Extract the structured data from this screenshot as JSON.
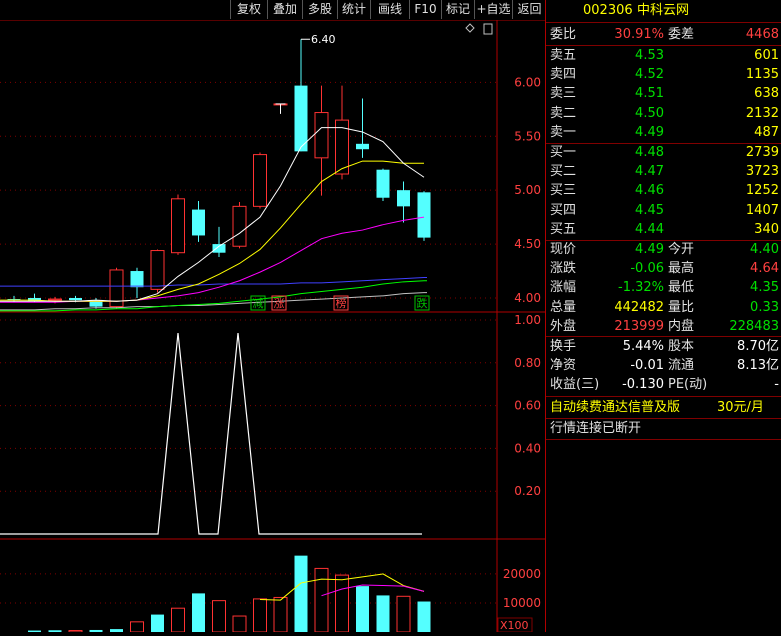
{
  "toolbar": {
    "buttons": [
      "复权",
      "叠加",
      "多股",
      "统计",
      "画线",
      "F10",
      "标记",
      "+自选",
      "返回"
    ]
  },
  "stock": {
    "code": "002306",
    "name": "中科云网"
  },
  "weibi": {
    "label1": "委比",
    "value1": "30.91%",
    "label2": "委差",
    "value2": "4468"
  },
  "asks": [
    {
      "label": "卖五",
      "price": "4.53",
      "volume": "601"
    },
    {
      "label": "卖四",
      "price": "4.52",
      "volume": "1135"
    },
    {
      "label": "卖三",
      "price": "4.51",
      "volume": "638"
    },
    {
      "label": "卖二",
      "price": "4.50",
      "volume": "2132"
    },
    {
      "label": "卖一",
      "price": "4.49",
      "volume": "487"
    }
  ],
  "bids": [
    {
      "label": "买一",
      "price": "4.48",
      "volume": "2739"
    },
    {
      "label": "买二",
      "price": "4.47",
      "volume": "3723"
    },
    {
      "label": "买三",
      "price": "4.46",
      "volume": "1252"
    },
    {
      "label": "买四",
      "price": "4.45",
      "volume": "1407"
    },
    {
      "label": "买五",
      "price": "4.44",
      "volume": "340"
    }
  ],
  "quote": [
    {
      "l1": "现价",
      "v1": "4.49",
      "c1": "green",
      "l2": "今开",
      "v2": "4.40",
      "c2": "green"
    },
    {
      "l1": "涨跌",
      "v1": "-0.06",
      "c1": "green",
      "l2": "最高",
      "v2": "4.64",
      "c2": "red"
    },
    {
      "l1": "涨幅",
      "v1": "-1.32%",
      "c1": "green",
      "l2": "最低",
      "v2": "4.35",
      "c2": "green"
    },
    {
      "l1": "总量",
      "v1": "442482",
      "c1": "yellow",
      "l2": "量比",
      "v2": "0.33",
      "c2": "green"
    },
    {
      "l1": "外盘",
      "v1": "213999",
      "c1": "red",
      "l2": "内盘",
      "v2": "228483",
      "c2": "green"
    }
  ],
  "fundamentals": [
    {
      "l1": "换手",
      "v1": "5.44%",
      "l2": "股本",
      "v2": "8.70亿"
    },
    {
      "l1": "净资",
      "v1": "-0.01",
      "l2": "流通",
      "v2": "8.13亿"
    },
    {
      "l1": "收益(三)",
      "v1": "-0.130",
      "l2": "PE(动)",
      "v2": "-"
    }
  ],
  "ad": {
    "text": "自动续费通达信普及版",
    "price": "30元/月"
  },
  "status": "行情连接已断开",
  "chart_data": [
    {
      "type": "candlestick",
      "title": "",
      "yticks": [
        6.0,
        5.5,
        5.0,
        4.5,
        4.0
      ],
      "ylim": [
        3.87,
        6.56
      ],
      "max_annotation": "6.40",
      "marks": [
        "减",
        "涨",
        "榜",
        "跌"
      ],
      "colors": {
        "up": "#ff3232",
        "down": "#54ffff",
        "ma5": "#ffffff",
        "ma10": "#ffff00",
        "ma20": "#ff00ff",
        "ma60": "#00ff00",
        "ma120": "#4040ff",
        "ma250": "#c0c0c0"
      },
      "candles": [
        {
          "o": 3.99,
          "h": 4.02,
          "l": 3.96,
          "c": 3.98
        },
        {
          "o": 4.0,
          "h": 4.04,
          "l": 3.96,
          "c": 3.97
        },
        {
          "o": 3.98,
          "h": 4.01,
          "l": 3.95,
          "c": 3.99
        },
        {
          "o": 4.0,
          "h": 4.02,
          "l": 3.96,
          "c": 3.98
        },
        {
          "o": 3.98,
          "h": 4.0,
          "l": 3.9,
          "c": 3.92
        },
        {
          "o": 3.92,
          "h": 4.28,
          "l": 3.9,
          "c": 4.26
        },
        {
          "o": 4.25,
          "h": 4.28,
          "l": 4.0,
          "c": 4.1
        },
        {
          "o": 4.08,
          "h": 4.45,
          "l": 4.05,
          "c": 4.44
        },
        {
          "o": 4.42,
          "h": 4.96,
          "l": 4.4,
          "c": 4.92
        },
        {
          "o": 4.82,
          "h": 4.9,
          "l": 4.52,
          "c": 4.58
        },
        {
          "o": 4.5,
          "h": 4.66,
          "l": 4.38,
          "c": 4.42
        },
        {
          "o": 4.48,
          "h": 4.89,
          "l": 4.46,
          "c": 4.85
        },
        {
          "o": 4.85,
          "h": 5.35,
          "l": 4.83,
          "c": 5.33
        },
        {
          "o": 5.8,
          "h": 5.8,
          "l": 5.8,
          "c": 5.8
        },
        {
          "o": 5.97,
          "h": 6.4,
          "l": 5.36,
          "c": 5.36
        },
        {
          "o": 5.3,
          "h": 5.97,
          "l": 4.95,
          "c": 5.72
        },
        {
          "o": 5.15,
          "h": 5.97,
          "l": 5.1,
          "c": 5.65
        },
        {
          "o": 5.43,
          "h": 5.85,
          "l": 5.3,
          "c": 5.38
        },
        {
          "o": 5.19,
          "h": 5.2,
          "l": 4.9,
          "c": 4.93
        },
        {
          "o": 5.0,
          "h": 5.08,
          "l": 4.7,
          "c": 4.85
        },
        {
          "o": 4.98,
          "h": 4.99,
          "l": 4.53,
          "c": 4.56
        }
      ],
      "ma5": [
        3.97,
        3.97,
        3.97,
        3.97,
        3.98,
        3.97,
        3.98,
        4.04,
        4.2,
        4.33,
        4.48,
        4.6,
        4.75,
        5.04,
        5.4,
        5.58,
        5.58,
        5.54,
        5.45,
        5.25,
        5.12
      ],
      "ma10": [
        3.98,
        3.98,
        3.97,
        3.97,
        3.97,
        3.97,
        3.98,
        4.02,
        4.08,
        4.13,
        4.22,
        4.32,
        4.45,
        4.65,
        4.87,
        5.08,
        5.2,
        5.27,
        5.27,
        5.25,
        5.25
      ],
      "ma20": [
        3.96,
        3.96,
        3.96,
        3.97,
        3.97,
        3.97,
        3.98,
        4.0,
        4.02,
        4.05,
        4.1,
        4.16,
        4.24,
        4.33,
        4.44,
        4.55,
        4.6,
        4.63,
        4.68,
        4.72,
        4.75
      ],
      "ma60": [
        3.88,
        3.88,
        3.88,
        3.89,
        3.89,
        3.9,
        3.9,
        3.92,
        3.93,
        3.94,
        3.95,
        3.97,
        3.99,
        4.01,
        4.04,
        4.06,
        4.08,
        4.1,
        4.13,
        4.15,
        4.16
      ],
      "ma120": [
        4.11,
        4.11,
        4.11,
        4.11,
        4.11,
        4.11,
        4.11,
        4.11,
        4.12,
        4.12,
        4.13,
        4.13,
        4.13,
        4.13,
        4.14,
        4.14,
        4.15,
        4.16,
        4.17,
        4.18,
        4.19
      ],
      "ma250": [
        3.89,
        3.89,
        3.9,
        3.9,
        3.91,
        3.91,
        3.92,
        3.92,
        3.93,
        3.93,
        3.94,
        3.95,
        3.96,
        3.97,
        3.98,
        3.99,
        4.0,
        4.01,
        4.02,
        4.04,
        4.05
      ]
    },
    {
      "type": "line",
      "yticks": [
        1.0,
        0.8,
        0.6,
        0.4,
        0.2
      ],
      "ylim": [
        -0.05,
        1.05
      ],
      "color": "#ffffff",
      "values": [
        0,
        0,
        0,
        0,
        0,
        0,
        0,
        0,
        0,
        1,
        0,
        0,
        1,
        0,
        0,
        0,
        0,
        0,
        0,
        0,
        0,
        0,
        0
      ]
    },
    {
      "type": "bar",
      "yticks": [
        20000,
        10000
      ],
      "ylim": [
        0,
        31000
      ],
      "unit": "X100",
      "up_color": "#ff3232",
      "down_color": "#54ffff",
      "volumes": [
        {
          "v": 500,
          "up": false
        },
        {
          "v": 600,
          "up": false
        },
        {
          "v": 500,
          "up": true
        },
        {
          "v": 700,
          "up": false
        },
        {
          "v": 1000,
          "up": false
        },
        {
          "v": 3500,
          "up": true
        },
        {
          "v": 6000,
          "up": false
        },
        {
          "v": 8200,
          "up": true
        },
        {
          "v": 13300,
          "up": false
        },
        {
          "v": 10800,
          "up": true
        },
        {
          "v": 5500,
          "up": true
        },
        {
          "v": 11400,
          "up": true
        },
        {
          "v": 11900,
          "up": true
        },
        {
          "v": 26300,
          "up": false
        },
        {
          "v": 21900,
          "up": true
        },
        {
          "v": 19600,
          "up": true
        },
        {
          "v": 15800,
          "up": false
        },
        {
          "v": 12600,
          "up": false
        },
        {
          "v": 12300,
          "up": true
        },
        {
          "v": 10500,
          "up": false
        }
      ],
      "ma5": [
        null,
        null,
        null,
        null,
        null,
        null,
        null,
        null,
        null,
        null,
        null,
        11200,
        11000,
        16900,
        18200,
        18000,
        19000,
        20000,
        16000,
        14000
      ],
      "ma10": [
        null,
        null,
        null,
        null,
        null,
        null,
        null,
        null,
        null,
        null,
        null,
        null,
        null,
        null,
        12500,
        14800,
        16200,
        16000,
        15800,
        14000
      ]
    }
  ]
}
